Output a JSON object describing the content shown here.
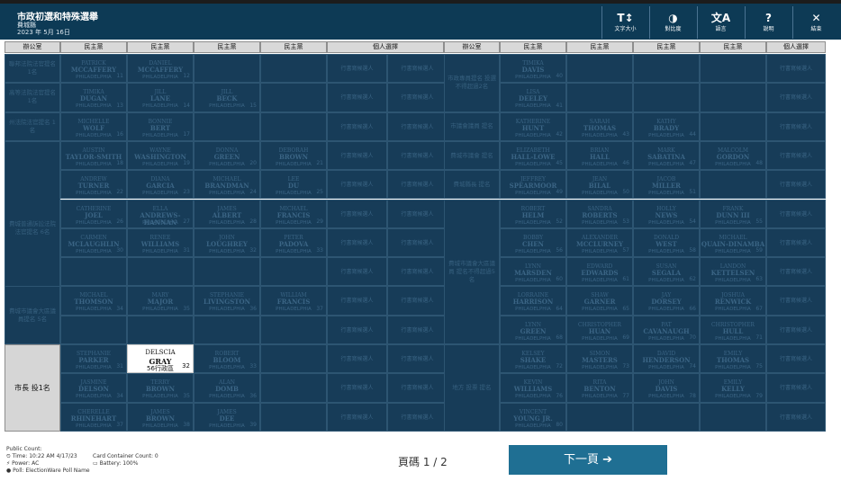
{
  "header": {
    "title": "市政初選和特殊選舉",
    "subtitle": "費城縣",
    "date": "2023 年 5月 16日",
    "buttons": [
      {
        "icon": "T↕",
        "label": "文字大小"
      },
      {
        "icon": "◑",
        "label": "對比度"
      },
      {
        "icon": "文A",
        "label": "語言"
      },
      {
        "icon": "?",
        "label": "說明"
      },
      {
        "icon": "✕",
        "label": "結束"
      }
    ]
  },
  "columns": {
    "office": "辦公室",
    "party": "民主黨",
    "write_in_header": "個人選擇"
  },
  "write_in_text": "行書寫候選人",
  "offices": {
    "left": [
      "聯邦法院法官提名 1名",
      "高等法院法官提名 1名",
      "州法院法官提名 1名",
      "費城普通訴訟法院法官提名 6名",
      "費城市議會大區議員提名 5名",
      "市長 投1名"
    ],
    "right": [
      "市政專員提名 投選不得超過2名",
      "市議會議員 提名",
      "費城市議會 提名",
      "費城縣長 提名",
      "費城市議會大區議員 提名不得超過5名",
      "地方 投票 提名"
    ]
  },
  "left_candidates": [
    [
      {
        "n1": "PATRICK",
        "n2": "MCCAFFERY",
        "s": "PHILADELPHIA",
        "no": "11"
      },
      {
        "n1": "DANIEL",
        "n2": "MCCAFFERY",
        "s": "PHILADELPHIA",
        "no": "12"
      }
    ],
    [
      {
        "n1": "TIMIKA",
        "n2": "DUGAN",
        "s": "PHILADELPHIA",
        "no": "13"
      },
      {
        "n1": "JILL",
        "n2": "LANE",
        "s": "PHILADELPHIA",
        "no": "14"
      },
      {
        "n1": "JILL",
        "n2": "BECK",
        "s": "PHILADELPHIA",
        "no": "15"
      }
    ],
    [
      {
        "n1": "MICHELLE",
        "n2": "WOLF",
        "s": "PHILADELPHIA",
        "no": "16"
      },
      {
        "n1": "BONNIE",
        "n2": "BERT",
        "s": "PHILADELPHIA",
        "no": "17"
      }
    ],
    [
      {
        "n1": "AUSTIN",
        "n2": "TAYLOR-SMITH",
        "s": "PHILADELPHIA",
        "no": "18"
      },
      {
        "n1": "WAYNE",
        "n2": "WASHINGTON",
        "s": "PHILADELPHIA",
        "no": "19"
      },
      {
        "n1": "DONNA",
        "n2": "GREEN",
        "s": "PHILADELPHIA",
        "no": "20"
      },
      {
        "n1": "DEBORAH",
        "n2": "BROWN",
        "s": "PHILADELPHIA",
        "no": "21"
      }
    ],
    [
      {
        "n1": "ANDREW",
        "n2": "TURNER",
        "s": "PHILADELPHIA",
        "no": "22"
      },
      {
        "n1": "DIANA",
        "n2": "GARCIA",
        "s": "PHILADELPHIA",
        "no": "23"
      },
      {
        "n1": "MICHAEL",
        "n2": "BRANDMAN",
        "s": "PHILADELPHIA",
        "no": "24"
      },
      {
        "n1": "LEE",
        "n2": "DU",
        "s": "PHILADELPHIA",
        "no": "25"
      }
    ],
    [
      {
        "n1": "CATHERINE",
        "n2": "JOEL",
        "s": "PHILADELPHIA",
        "no": "26"
      },
      {
        "n1": "ELLA",
        "n2": "ANDREWS-HANNAN",
        "s": "PHILADELPHIA",
        "no": "27"
      },
      {
        "n1": "JAMES",
        "n2": "ALBERT",
        "s": "PHILADELPHIA",
        "no": "28"
      },
      {
        "n1": "MICHAEL",
        "n2": "FRANCIS",
        "s": "PHILADELPHIA",
        "no": "29"
      }
    ],
    [
      {
        "n1": "CARMEN",
        "n2": "MCLAUGHLIN",
        "s": "PHILADELPHIA",
        "no": "30"
      },
      {
        "n1": "RENEE",
        "n2": "WILLIAMS",
        "s": "PHILADELPHIA",
        "no": "31"
      },
      {
        "n1": "JOHN",
        "n2": "LOUGHREY",
        "s": "PHILADELPHIA",
        "no": "32"
      },
      {
        "n1": "PETER",
        "n2": "PADOVA",
        "s": "PHILADELPHIA",
        "no": "33"
      }
    ],
    [],
    [
      {
        "n1": "MICHAEL",
        "n2": "THOMSON",
        "s": "PHILADELPHIA",
        "no": "34"
      },
      {
        "n1": "MARY",
        "n2": "MAJOR",
        "s": "PHILADELPHIA",
        "no": "35"
      },
      {
        "n1": "STEPHANIE",
        "n2": "LIVINGSTON",
        "s": "PHILADELPHIA",
        "no": "36"
      },
      {
        "n1": "WILLIAM",
        "n2": "FRANCIS",
        "s": "PHILADELPHIA",
        "no": "37"
      }
    ],
    [],
    [
      {
        "n1": "STEPHANIE",
        "n2": "PARKER",
        "s": "PHILADELPHIA",
        "no": "31"
      },
      {
        "n1": "DELSCIA",
        "n2": "GRAY",
        "s": "56行政區",
        "no": "32"
      },
      {
        "n1": "ROBERT",
        "n2": "BLOOM",
        "s": "PHILADELPHIA",
        "no": "33"
      }
    ],
    [
      {
        "n1": "JASMINE",
        "n2": "DELSON",
        "s": "PHILADELPHIA",
        "no": "34"
      },
      {
        "n1": "TERRY",
        "n2": "BROWN",
        "s": "PHILADELPHIA",
        "no": "35"
      },
      {
        "n1": "ALAN",
        "n2": "DOMB",
        "s": "PHILADELPHIA",
        "no": "36"
      }
    ],
    [
      {
        "n1": "CHERELLE",
        "n2": "RHINEHART",
        "s": "PHILADELPHIA",
        "no": "37"
      },
      {
        "n1": "JAMES",
        "n2": "BROWN",
        "s": "PHILADELPHIA",
        "no": "38"
      },
      {
        "n1": "JAMES",
        "n2": "DEE",
        "s": "PHILADELPHIA",
        "no": "39"
      }
    ]
  ],
  "right_candidates": [
    [
      {
        "n1": "TIMIKA",
        "n2": "DAVIS",
        "s": "PHILADELPHIA",
        "no": "40"
      }
    ],
    [
      {
        "n1": "LISA",
        "n2": "DEELEY",
        "s": "PHILADELPHIA",
        "no": "41"
      }
    ],
    [
      {
        "n1": "KATHERINE",
        "n2": "HUNT",
        "s": "PHILADELPHIA",
        "no": "42"
      },
      {
        "n1": "SARAH",
        "n2": "THOMAS",
        "s": "PHILADELPHIA",
        "no": "43"
      },
      {
        "n1": "KATHY",
        "n2": "BRADY",
        "s": "PHILADELPHIA",
        "no": "44"
      }
    ],
    [
      {
        "n1": "ELIZABETH",
        "n2": "HALL-LOWE",
        "s": "PHILADELPHIA",
        "no": "45"
      },
      {
        "n1": "BRIAN",
        "n2": "HALL",
        "s": "PHILADELPHIA",
        "no": "46"
      },
      {
        "n1": "MARK",
        "n2": "SABATINA",
        "s": "PHILADELPHIA",
        "no": "47"
      },
      {
        "n1": "MALCOLM",
        "n2": "GORDON",
        "s": "PHILADELPHIA",
        "no": "48"
      }
    ],
    [
      {
        "n1": "JEFFREY",
        "n2": "SPEARMOOR",
        "s": "PHILADELPHIA",
        "no": "49"
      },
      {
        "n1": "JEAN",
        "n2": "BILAL",
        "s": "PHILADELPHIA",
        "no": "50"
      },
      {
        "n1": "JACOB",
        "n2": "MILLER",
        "s": "PHILADELPHIA",
        "no": "51"
      }
    ],
    [
      {
        "n1": "ROBERT",
        "n2": "HELM",
        "s": "PHILADELPHIA",
        "no": "52"
      },
      {
        "n1": "SANDRA",
        "n2": "ROBERTS",
        "s": "PHILADELPHIA",
        "no": "53"
      },
      {
        "n1": "HOLLY",
        "n2": "NEWS",
        "s": "PHILADELPHIA",
        "no": "54"
      },
      {
        "n1": "FRANK",
        "n2": "DUNN III",
        "s": "PHILADELPHIA",
        "no": "55"
      }
    ],
    [
      {
        "n1": "BOBBY",
        "n2": "CHEN",
        "s": "PHILADELPHIA",
        "no": "56"
      },
      {
        "n1": "ALEXANDER",
        "n2": "MCCLURNEY",
        "s": "PHILADELPHIA",
        "no": "57"
      },
      {
        "n1": "DONALD",
        "n2": "WEST",
        "s": "PHILADELPHIA",
        "no": "58"
      },
      {
        "n1": "MICHAEL",
        "n2": "QUAIN-DINAMBA",
        "s": "PHILADELPHIA",
        "no": "59"
      }
    ],
    [
      {
        "n1": "LYNN",
        "n2": "MARSDEN",
        "s": "PHILADELPHIA",
        "no": "60"
      },
      {
        "n1": "EDWARD",
        "n2": "EDWARDS",
        "s": "PHILADELPHIA",
        "no": "61"
      },
      {
        "n1": "SUSAN",
        "n2": "SEGALA",
        "s": "PHILADELPHIA",
        "no": "62"
      },
      {
        "n1": "LANDON",
        "n2": "KETTELSEN",
        "s": "PHILADELPHIA",
        "no": "63"
      }
    ],
    [
      {
        "n1": "LORRAINE",
        "n2": "HARRISON",
        "s": "PHILADELPHIA",
        "no": "64"
      },
      {
        "n1": "SHAW",
        "n2": "GARNER",
        "s": "PHILADELPHIA",
        "no": "65"
      },
      {
        "n1": "JAY",
        "n2": "DORSEY",
        "s": "PHILADELPHIA",
        "no": "66"
      },
      {
        "n1": "JOSHUA",
        "n2": "RENWICK",
        "s": "PHILADELPHIA",
        "no": "67"
      }
    ],
    [
      {
        "n1": "LYNN",
        "n2": "GREEN",
        "s": "PHILADELPHIA",
        "no": "68"
      },
      {
        "n1": "CHRISTOPHER",
        "n2": "HUAN",
        "s": "PHILADELPHIA",
        "no": "69"
      },
      {
        "n1": "PAT",
        "n2": "CAVANAUGH",
        "s": "PHILADELPHIA",
        "no": "70"
      },
      {
        "n1": "CHRISTOPHER",
        "n2": "HULL",
        "s": "PHILADELPHIA",
        "no": "71"
      }
    ],
    [
      {
        "n1": "KELSEY",
        "n2": "SHAKE",
        "s": "PHILADELPHIA",
        "no": "72"
      },
      {
        "n1": "SIMON",
        "n2": "MASTERS",
        "s": "PHILADELPHIA",
        "no": "73"
      },
      {
        "n1": "DAVID",
        "n2": "HENDERSON",
        "s": "PHILADELPHIA",
        "no": "74"
      },
      {
        "n1": "EMILY",
        "n2": "THOMAS",
        "s": "PHILADELPHIA",
        "no": "75"
      }
    ],
    [
      {
        "n1": "KEVIN",
        "n2": "WILLIAMS",
        "s": "PHILADELPHIA",
        "no": "76"
      },
      {
        "n1": "RITA",
        "n2": "BENTON",
        "s": "PHILADELPHIA",
        "no": "77"
      },
      {
        "n1": "JOHN",
        "n2": "DAVIS",
        "s": "PHILADELPHIA",
        "no": "78"
      },
      {
        "n1": "EMILY",
        "n2": "KELLY",
        "s": "PHILADELPHIA",
        "no": "79"
      }
    ],
    [
      {
        "n1": "VINCENT",
        "n2": "YOUNG JR.",
        "s": "PHILADELPHIA",
        "no": "80"
      }
    ]
  ],
  "footer": {
    "public_count": "Public Count:",
    "time": "Time: 10:22 AM 4/17/23",
    "power": "Power: AC",
    "poll": "Poll: ElectionWare Poll Name",
    "card_count": "Card Container Count: 0",
    "battery": "Battery: 100%",
    "page": "頁碼 1 / 2",
    "next_label": "下一頁 ➔"
  },
  "colors": {
    "header_bg": "#0d3a55",
    "cell_bg": "#173c58",
    "next_bg": "#1f6f93"
  }
}
